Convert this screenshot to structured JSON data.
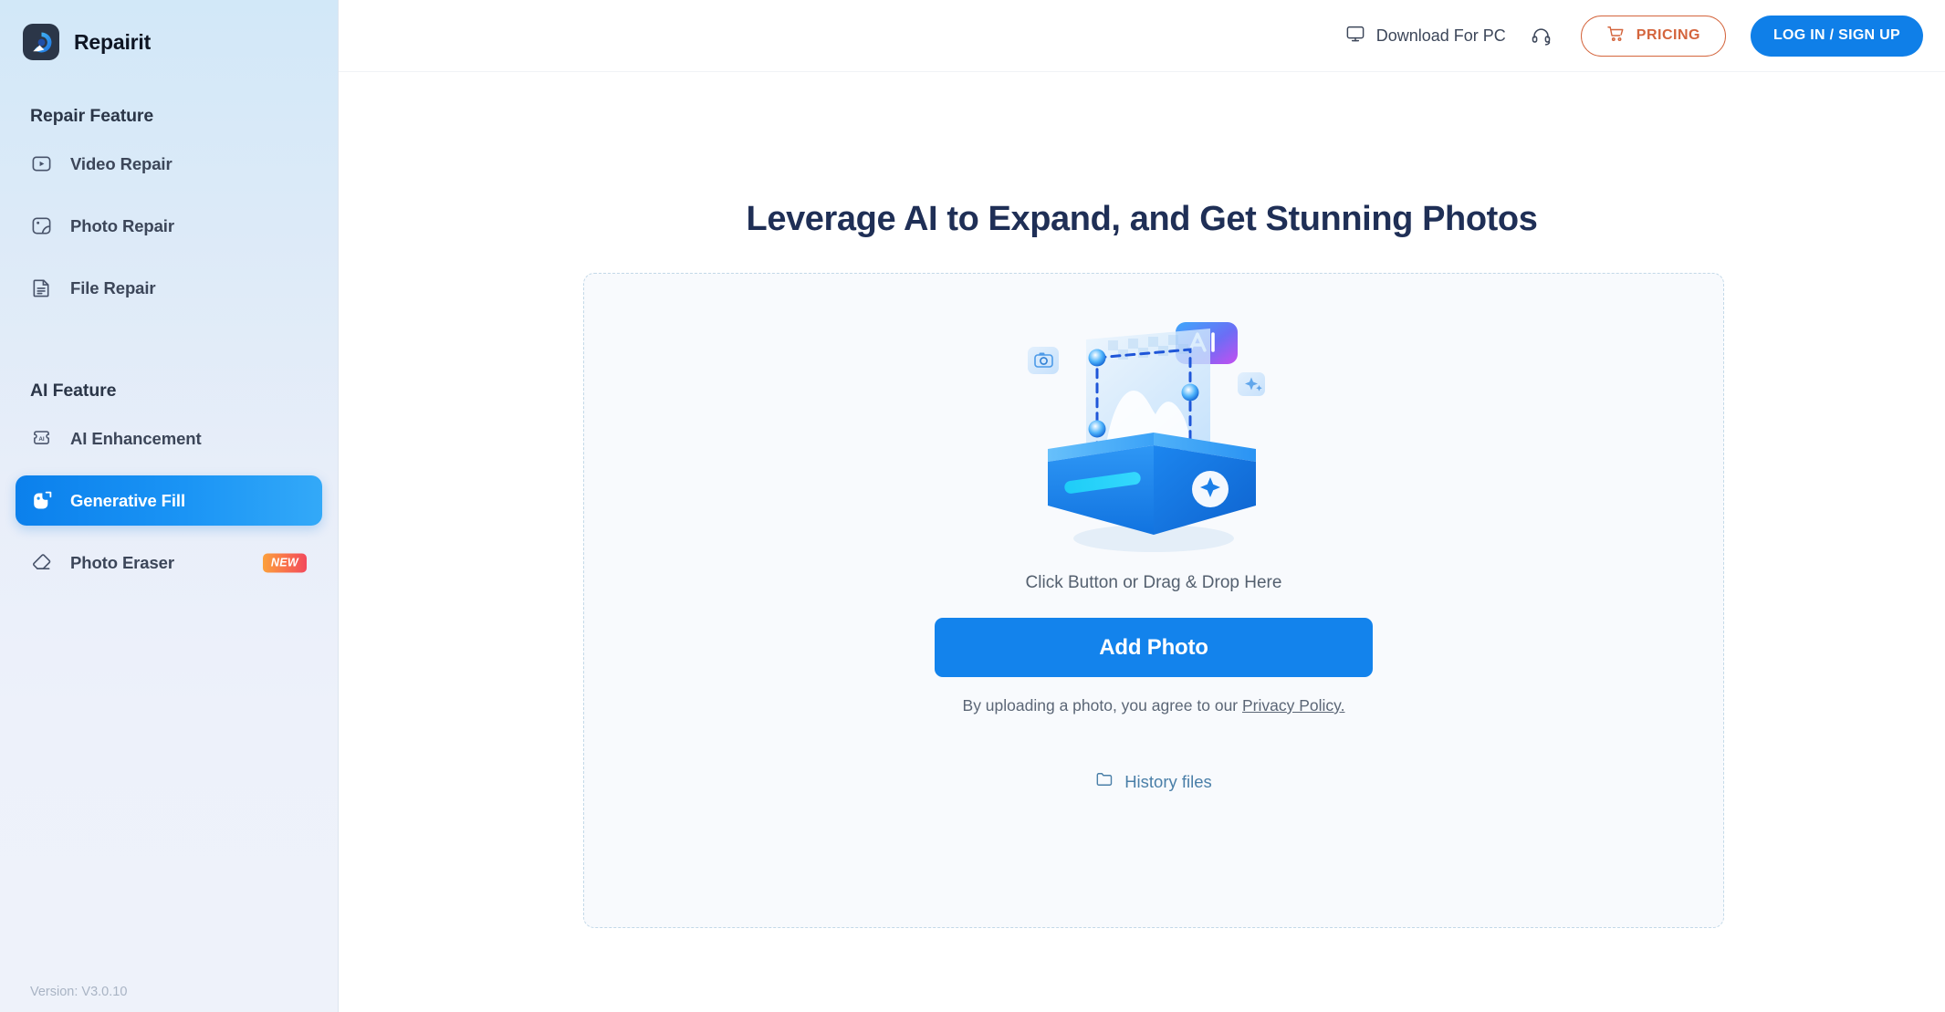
{
  "app": {
    "brand_name": "Repairit",
    "version_label": "Version: V3.0.10",
    "accent_blue": "#1383ec",
    "accent_orange": "#d4653d",
    "active_nav_gradient_from": "#0b80ec",
    "active_nav_gradient_to": "#33a9f8"
  },
  "sidebar": {
    "logo_icon": "repairit-logo-icon",
    "groups": [
      {
        "title": "Repair Feature",
        "items": [
          {
            "label": "Video Repair",
            "icon": "video-repair-icon",
            "active": false,
            "badge": ""
          },
          {
            "label": "Photo Repair",
            "icon": "photo-repair-icon",
            "active": false,
            "badge": ""
          },
          {
            "label": "File Repair",
            "icon": "file-repair-icon",
            "active": false,
            "badge": ""
          }
        ]
      },
      {
        "title": "AI Feature",
        "items": [
          {
            "label": "AI Enhancement",
            "icon": "ai-enhancement-icon",
            "active": false,
            "badge": ""
          },
          {
            "label": "Generative Fill",
            "icon": "generative-fill-icon",
            "active": true,
            "badge": ""
          },
          {
            "label": "Photo Eraser",
            "icon": "photo-eraser-icon",
            "active": false,
            "badge": "NEW"
          }
        ]
      }
    ]
  },
  "topbar": {
    "download_label": "Download For PC",
    "download_icon": "monitor-icon",
    "support_icon": "headset-icon",
    "pricing_label": "PRICING",
    "pricing_icon": "cart-icon",
    "login_label": "LOG IN / SIGN UP"
  },
  "main": {
    "hero_title": "Leverage AI to Expand, and Get Stunning Photos",
    "illustration_name": "generative-fill-illustration",
    "dropzone_hint": "Click Button or Drag & Drop Here",
    "add_photo_label": "Add Photo",
    "policy_prefix": "By uploading a photo, you agree to our ",
    "policy_link": "Privacy Policy.",
    "history_label": "History files",
    "history_icon": "folder-icon"
  }
}
